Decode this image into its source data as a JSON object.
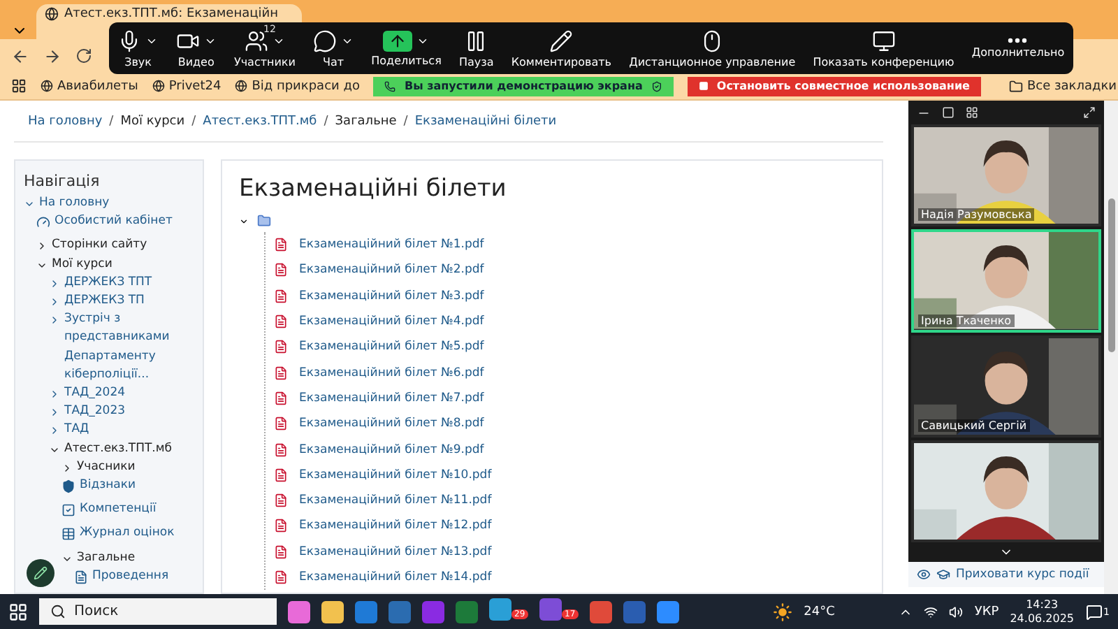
{
  "browser": {
    "tab_title": "Атест.екз.ТПТ.мб: Екзаменаційн",
    "bookmarks": [
      "Авиабилеты",
      "Privet24",
      "Від прикраси до"
    ],
    "all_bookmarks": "Все закладки"
  },
  "share_banner": {
    "status": "Вы запустили демонстрацию экрана",
    "stop": "Остановить совместное использование"
  },
  "meeting_toolbar": [
    {
      "kind": "mic",
      "label": "Звук",
      "menu": true
    },
    {
      "kind": "camera",
      "label": "Видео",
      "menu": true
    },
    {
      "kind": "people",
      "label": "Участники",
      "menu": true,
      "count": "12"
    },
    {
      "kind": "chat",
      "label": "Чат",
      "menu": true
    },
    {
      "kind": "share",
      "label": "Поделиться",
      "menu": true
    },
    {
      "kind": "pause",
      "label": "Пауза",
      "menu": false
    },
    {
      "kind": "pen",
      "label": "Комментировать",
      "menu": false
    },
    {
      "kind": "mouse",
      "label": "Дистанционное управление",
      "menu": false
    },
    {
      "kind": "monitor",
      "label": "Показать конференцию",
      "menu": false
    },
    {
      "kind": "more",
      "label": "Дополнительно",
      "menu": false
    }
  ],
  "breadcrumb": [
    {
      "label": "На головну",
      "link": true
    },
    {
      "separator": "/",
      "label": "Мої курси",
      "link": false
    },
    {
      "separator": "/",
      "label": "Атест.екз.ТПТ.мб",
      "link": true
    },
    {
      "separator": "/",
      "label": "Загальне",
      "link": false
    },
    {
      "separator": "/",
      "label": "Екзаменаційні білети",
      "link": true
    }
  ],
  "navigation": {
    "title": "Навігація",
    "items": [
      {
        "kind": "branch",
        "label": "На головну",
        "link": true,
        "expanded": true,
        "children": [
          {
            "kind": "dashboard",
            "label": "Особистий кабінет",
            "link": true
          },
          {
            "kind": "branch",
            "label": "Сторінки сайту",
            "link": false,
            "expanded": false
          },
          {
            "kind": "branch",
            "label": "Мої курси",
            "link": false,
            "expanded": true,
            "children": [
              {
                "kind": "branch",
                "label": "ДЕРЖЕКЗ ТПТ",
                "link": true,
                "expanded": false
              },
              {
                "kind": "branch",
                "label": "ДЕРЖЕКЗ ТП",
                "link": true,
                "expanded": false
              },
              {
                "kind": "branch",
                "label": "Зустріч з представниками Департаменту кіберполіції...",
                "link": true,
                "expanded": false
              },
              {
                "kind": "branch",
                "label": "ТАД_2024",
                "link": true,
                "expanded": false
              },
              {
                "kind": "branch",
                "label": "ТАД_2023",
                "link": true,
                "expanded": false
              },
              {
                "kind": "branch",
                "label": "ТАД",
                "link": true,
                "expanded": false
              },
              {
                "kind": "branch",
                "label": "Атест.екз.ТПТ.мб",
                "link": false,
                "expanded": true,
                "children": [
                  {
                    "kind": "branch",
                    "label": "Учасники",
                    "link": false,
                    "expanded": false
                  },
                  {
                    "kind": "badge",
                    "label": "Відзнаки",
                    "link": true
                  },
                  {
                    "kind": "check",
                    "label": "Компетенції",
                    "link": true
                  },
                  {
                    "kind": "table",
                    "label": "Журнал оцінок",
                    "link": true
                  },
                  {
                    "kind": "branch",
                    "label": "Загальне",
                    "link": false,
                    "expanded": true,
                    "children": [
                      {
                        "kind": "file",
                        "label": "Проведення",
                        "link": true
                      }
                    ]
                  }
                ]
              }
            ]
          }
        ]
      }
    ]
  },
  "content": {
    "title": "Екзаменаційні білети",
    "folder_expanded": true,
    "files": [
      "Екзаменаційний білет №1.pdf",
      "Екзаменаційний білет №2.pdf",
      "Екзаменаційний білет №3.pdf",
      "Екзаменаційний білет №4.pdf",
      "Екзаменаційний білет №5.pdf",
      "Екзаменаційний білет №6.pdf",
      "Екзаменаційний білет №7.pdf",
      "Екзаменаційний білет №8.pdf",
      "Екзаменаційний білет №9.pdf",
      "Екзаменаційний білет №10.pdf",
      "Екзаменаційний білет №11.pdf",
      "Екзаменаційний білет №12.pdf",
      "Екзаменаційний білет №13.pdf",
      "Екзаменаційний білет №14.pdf"
    ]
  },
  "video_panel": {
    "tiles": [
      {
        "name": "Надія Разумовська",
        "speaking": false
      },
      {
        "name": "Ірина Ткаченко",
        "speaking": true
      },
      {
        "name": "Савицький Сергій",
        "speaking": false
      },
      {
        "speaking": false
      }
    ]
  },
  "side_block": {
    "item": "Приховати курс події"
  },
  "taskbar": {
    "search": "Поиск",
    "badges": [
      {
        "count": "29"
      },
      {
        "count": "17"
      }
    ],
    "weather": "24°C",
    "language": "УКР",
    "time": "14:23",
    "date": "24.06.2025",
    "notifications": "1"
  }
}
